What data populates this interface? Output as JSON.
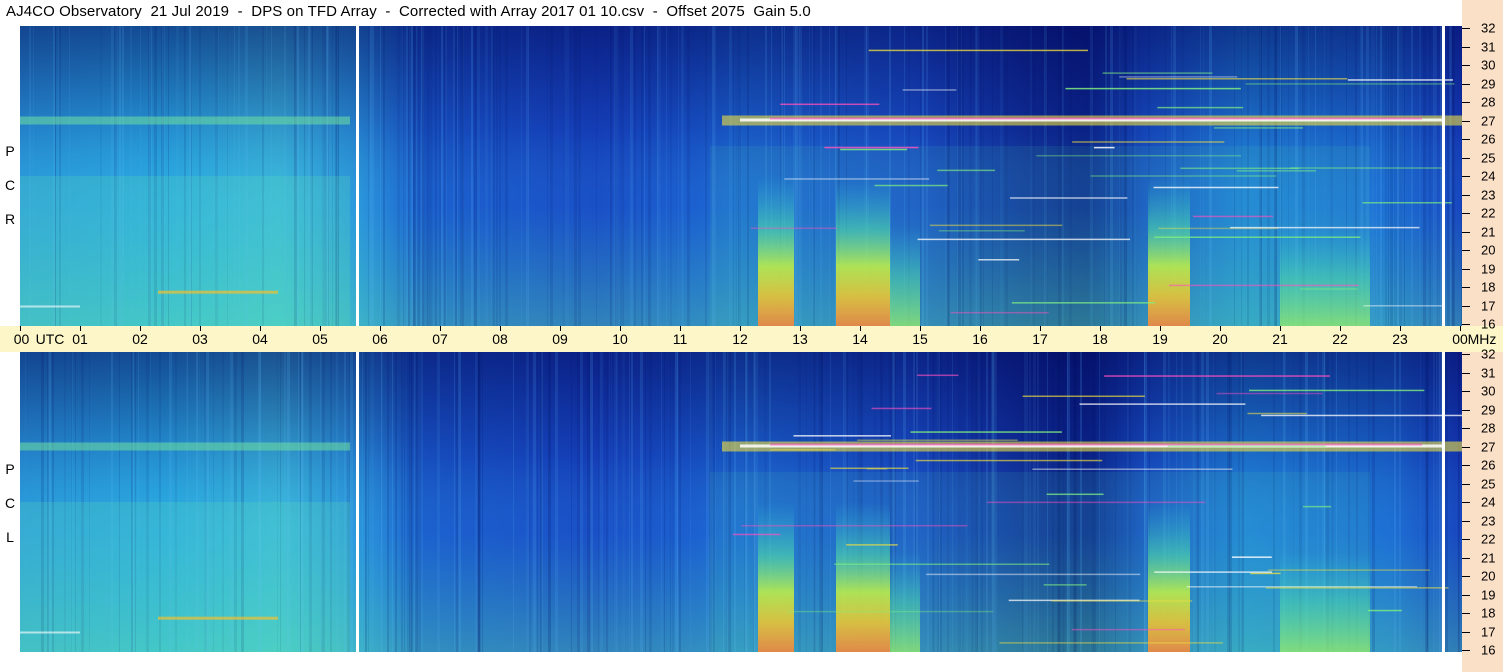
{
  "title": "AJ4CO Observatory  21 Jul 2019  -  DPS on TFD Array  -  Corrected with Array 2017 01 10.csv  -  Offset 2075  Gain 5.0",
  "chart_data": {
    "type": "heatmap",
    "title": "AJ4CO Observatory  21 Jul 2019  -  DPS on TFD Array  -  Corrected with Array 2017 01 10.csv  -  Offset 2075  Gain 5.0",
    "x_axis": {
      "unit_label": "UTC",
      "range_hours": [
        0,
        24
      ],
      "tick_labels": [
        "00",
        "01",
        "02",
        "03",
        "04",
        "05",
        "06",
        "07",
        "08",
        "09",
        "10",
        "11",
        "12",
        "13",
        "14",
        "15",
        "16",
        "17",
        "18",
        "19",
        "20",
        "21",
        "22",
        "23",
        "00"
      ]
    },
    "y_axis": {
      "unit_label": "MHz",
      "range_mhz": [
        16,
        32
      ],
      "tick_labels": [
        "16",
        "17",
        "18",
        "19",
        "20",
        "21",
        "22",
        "23",
        "24",
        "25",
        "26",
        "27",
        "28",
        "29",
        "30",
        "31",
        "32"
      ]
    },
    "panels": [
      {
        "name": "RCP",
        "letters": [
          "R",
          "C",
          "P"
        ]
      },
      {
        "name": "LCP",
        "letters": [
          "L",
          "C",
          "P"
        ]
      }
    ],
    "colormap": [
      "#00008c",
      "#1e3cc8",
      "#1e78e6",
      "#28b4e6",
      "#50dcaa",
      "#b4f050",
      "#f0e632",
      "#f08c3c",
      "#e6507a",
      "#ff3cc8",
      "#ffffff"
    ],
    "gap_lines_hours": [
      5.6,
      23.7
    ],
    "activity_regions_hours": [
      {
        "start": 12.3,
        "end": 12.9,
        "intensity": "high"
      },
      {
        "start": 13.6,
        "end": 14.5,
        "intensity": "high"
      },
      {
        "start": 14.5,
        "end": 15.0,
        "intensity": "medium"
      },
      {
        "start": 18.8,
        "end": 19.5,
        "intensity": "high"
      },
      {
        "start": 21.0,
        "end": 22.5,
        "intensity": "medium"
      }
    ],
    "interference_band_mhz": 27.0
  }
}
